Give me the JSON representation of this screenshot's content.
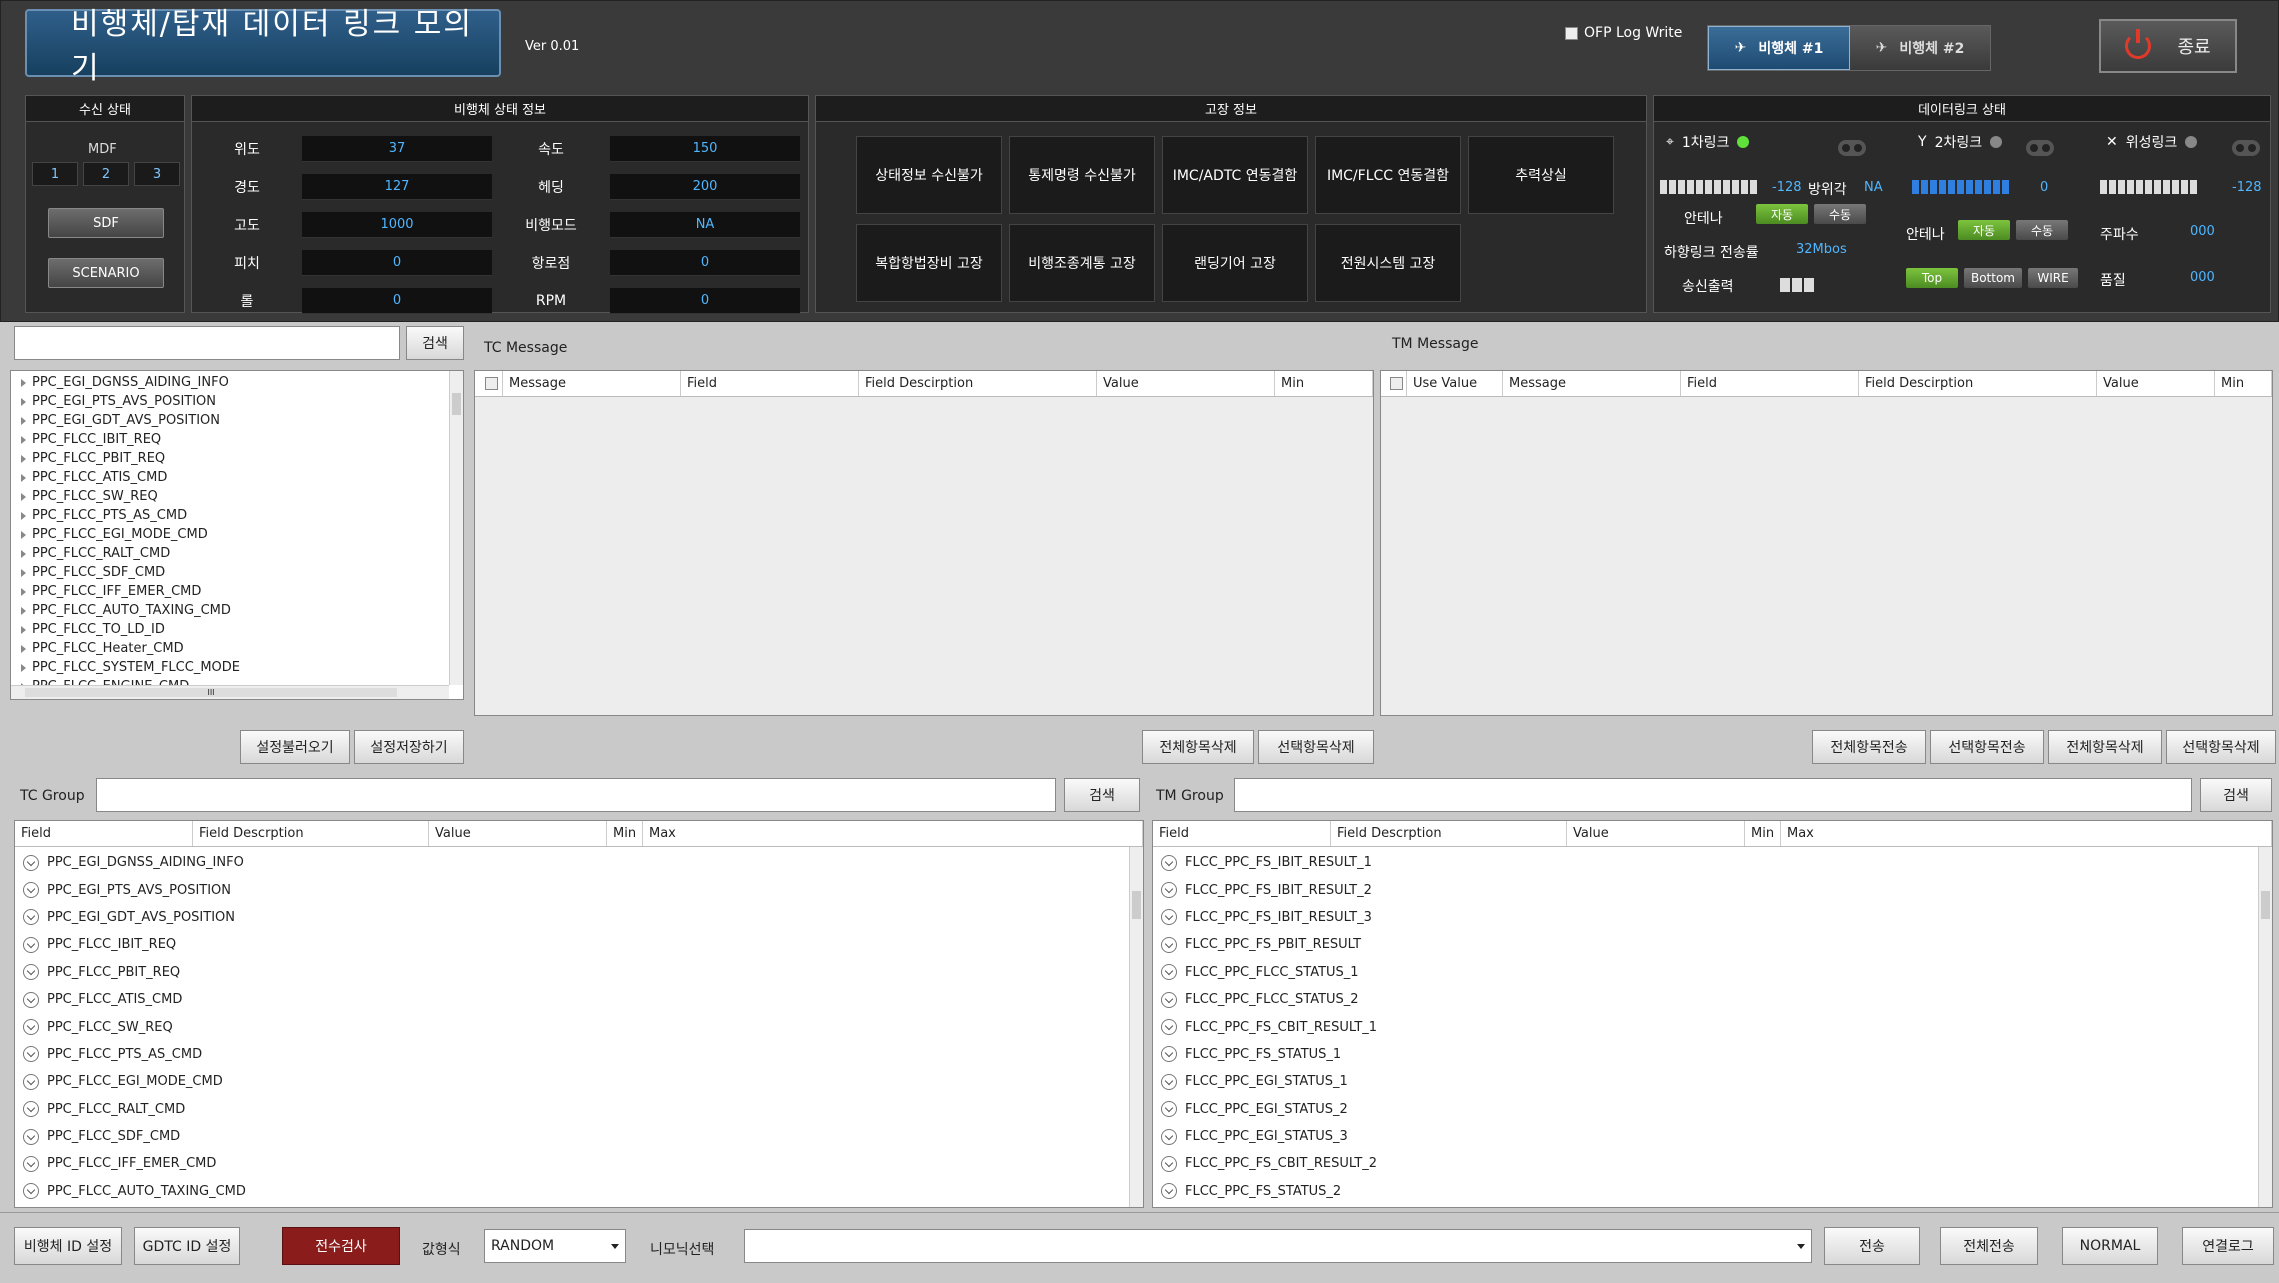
{
  "header": {
    "app_title": "비행체/탑재 데이터 링크 모의기",
    "version": "Ver 0.01",
    "ofp_log_label": "OFP Log Write",
    "uav1_label": "비행체 #1",
    "uav2_label": "비행체 #2",
    "exit_label": "종료"
  },
  "reception": {
    "title": "수신 상태",
    "mdf_label": "MDF",
    "channels": [
      "1",
      "2",
      "3"
    ],
    "sdf_label": "SDF",
    "scenario_label": "SCENARIO"
  },
  "vehicle_status": {
    "title": "비행체 상태 정보",
    "rows": [
      {
        "label": "위도",
        "value": "37",
        "label2": "속도",
        "value2": "150"
      },
      {
        "label": "경도",
        "value": "127",
        "label2": "헤딩",
        "value2": "200"
      },
      {
        "label": "고도",
        "value": "1000",
        "label2": "비행모드",
        "value2": "NA"
      },
      {
        "label": "피치",
        "value": "0",
        "label2": "항로점",
        "value2": "0"
      },
      {
        "label": "롤",
        "value": "0",
        "label2": "RPM",
        "value2": "0"
      }
    ]
  },
  "fault": {
    "title": "고장 정보",
    "items": [
      "상태정보 수신불가",
      "통제명령 수신불가",
      "IMC/ADTC 연동결함",
      "IMC/FLCC 연동결함",
      "추력상실",
      "복합항법장비 고장",
      "비행조종계통 고장",
      "랜딩기어 고장",
      "전원시스템 고장"
    ]
  },
  "datalink": {
    "title": "데이터링크 상태",
    "link1": {
      "label": "1차링크",
      "signal": "-128",
      "azimuth_label": "방위각",
      "azimuth": "NA",
      "antenna_label": "안테나",
      "auto": "자동",
      "manual": "수동",
      "downlink_label": "하향링크 전송률",
      "downlink": "32Mbos",
      "tx_label": "송신출력"
    },
    "link2": {
      "label": "2차링크",
      "signal": "0",
      "antenna_label": "안테나",
      "auto": "자동",
      "manual": "수동",
      "top": "Top",
      "bottom": "Bottom",
      "wire": "WIRE"
    },
    "sat": {
      "label": "위성링크",
      "signal": "-128",
      "freq_label": "주파수",
      "freq": "000",
      "quality_label": "품질",
      "quality": "000"
    }
  },
  "search": {
    "button": "검색"
  },
  "tree": {
    "items": [
      "PPC_EGI_DGNSS_AIDING_INFO",
      "PPC_EGI_PTS_AVS_POSITION",
      "PPC_EGI_GDT_AVS_POSITION",
      "PPC_FLCC_IBIT_REQ",
      "PPC_FLCC_PBIT_REQ",
      "PPC_FLCC_ATIS_CMD",
      "PPC_FLCC_SW_REQ",
      "PPC_FLCC_PTS_AS_CMD",
      "PPC_FLCC_EGI_MODE_CMD",
      "PPC_FLCC_RALT_CMD",
      "PPC_FLCC_SDF_CMD",
      "PPC_FLCC_IFF_EMER_CMD",
      "PPC_FLCC_AUTO_TAXING_CMD",
      "PPC_FLCC_TO_LD_ID",
      "PPC_FLCC_Heater_CMD",
      "PPC_FLCC_SYSTEM_FLCC_MODE",
      "PPC_FLCC_ENGINE_CMD"
    ],
    "hscroll_thumb": "III"
  },
  "tc_message": {
    "label": "TC Message",
    "columns": [
      "Message",
      "Field",
      "Field Descirption",
      "Value",
      "Min"
    ]
  },
  "tm_message": {
    "label": "TM Message",
    "columns": [
      "Use Value",
      "Message",
      "Field",
      "Field Descirption",
      "Value",
      "Min"
    ]
  },
  "mid_buttons": {
    "load_settings": "설정불러오기",
    "save_settings": "설정저장하기",
    "tc_delete_all": "전체항목삭제",
    "tc_delete_sel": "선택항목삭제",
    "tm_send_all": "전체항목전송",
    "tm_send_sel": "선택항목전송",
    "tm_delete_all": "전체항목삭제",
    "tm_delete_sel": "선택항목삭제"
  },
  "tc_group": {
    "label": "TC Group",
    "columns": [
      "Field",
      "Field Descrption",
      "Value",
      "Min",
      "Max"
    ],
    "items": [
      "PPC_EGI_DGNSS_AIDING_INFO",
      "PPC_EGI_PTS_AVS_POSITION",
      "PPC_EGI_GDT_AVS_POSITION",
      "PPC_FLCC_IBIT_REQ",
      "PPC_FLCC_PBIT_REQ",
      "PPC_FLCC_ATIS_CMD",
      "PPC_FLCC_SW_REQ",
      "PPC_FLCC_PTS_AS_CMD",
      "PPC_FLCC_EGI_MODE_CMD",
      "PPC_FLCC_RALT_CMD",
      "PPC_FLCC_SDF_CMD",
      "PPC_FLCC_IFF_EMER_CMD",
      "PPC_FLCC_AUTO_TAXING_CMD"
    ]
  },
  "tm_group": {
    "label": "TM Group",
    "columns": [
      "Field",
      "Field Descrption",
      "Value",
      "Min",
      "Max"
    ],
    "items": [
      "FLCC_PPC_FS_IBIT_RESULT_1",
      "FLCC_PPC_FS_IBIT_RESULT_2",
      "FLCC_PPC_FS_IBIT_RESULT_3",
      "FLCC_PPC_FS_PBIT_RESULT",
      "FLCC_PPC_FLCC_STATUS_1",
      "FLCC_PPC_FLCC_STATUS_2",
      "FLCC_PPC_FS_CBIT_RESULT_1",
      "FLCC_PPC_FS_STATUS_1",
      "FLCC_PPC_EGI_STATUS_1",
      "FLCC_PPC_EGI_STATUS_2",
      "FLCC_PPC_EGI_STATUS_3",
      "FLCC_PPC_FS_CBIT_RESULT_2",
      "FLCC_PPC_FS_STATUS_2"
    ]
  },
  "bottom": {
    "uav_id": "비행체 ID 설정",
    "gdtc_id": "GDTC ID 설정",
    "full_check": "전수검사",
    "value_mode_label": "값형식",
    "value_mode": "RANDOM",
    "mnemonic_label": "니모닉선택",
    "mnemonic": "",
    "send": "전송",
    "send_all": "전체전송",
    "normal": "NORMAL",
    "conn_log": "연결로그"
  },
  "colors": {
    "accent_blue": "#4fb6ff",
    "led_green": "#5fe03a",
    "full_check_red": "#8b1c1c"
  }
}
